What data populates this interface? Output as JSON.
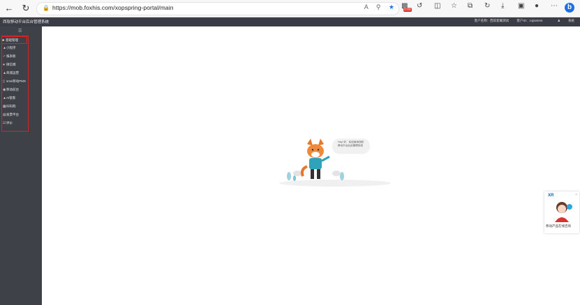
{
  "browser": {
    "url": "https://mob.foxhis.com/xopspring-portal/main",
    "badge": "0:00",
    "bing_label": "b"
  },
  "header": {
    "title": "西软移动平台后台管理系统",
    "customer_name": "客户名称：西软套餐测试",
    "customer_id": "客户ID：zujiantest",
    "user": "系统"
  },
  "sidebar": {
    "items": [
      {
        "label": "基础管理",
        "icon": "grid-icon"
      },
      {
        "label": "小程序",
        "icon": "shop-icon"
      },
      {
        "label": "报表板",
        "icon": "chart-icon"
      },
      {
        "label": "微信端",
        "icon": "wechat-icon"
      },
      {
        "label": "商城运营",
        "icon": "cart-icon"
      },
      {
        "label": "smsi移动PMS",
        "icon": "phone-icon"
      },
      {
        "label": "移动前台",
        "icon": "front-icon"
      },
      {
        "label": "AI管家",
        "icon": "robot-icon"
      },
      {
        "label": "扫码购",
        "icon": "scan-icon"
      },
      {
        "label": "发票平台",
        "icon": "invoice-icon"
      },
      {
        "label": "评价",
        "icon": "review-icon"
      }
    ]
  },
  "welcome": {
    "bubble": "Hey! 好，欢迎使用西软移动平台后台管理系统"
  },
  "float_panel": {
    "logo": "XR",
    "label": "移动产品在线咨询"
  }
}
